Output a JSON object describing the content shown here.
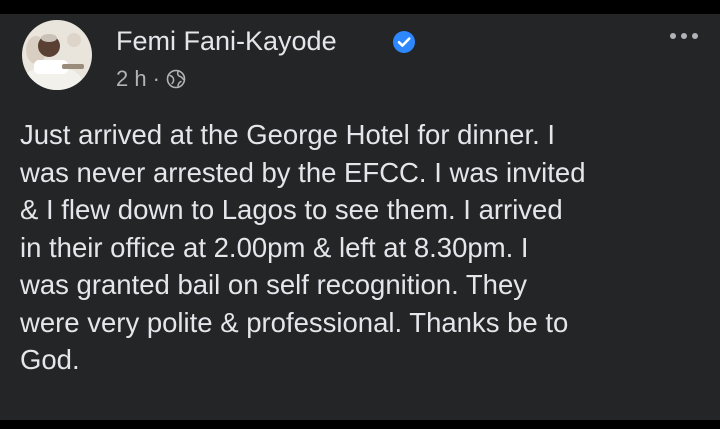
{
  "post": {
    "author": {
      "name": "Femi Fani-Kayode",
      "verified": true,
      "avatar_icon": "profile-photo"
    },
    "meta": {
      "time": "2 h",
      "separator": "·",
      "audience_icon": "globe-icon"
    },
    "more_icon": "more-horizontal-icon",
    "text": "Just arrived at the George Hotel for dinner. I\nwas never arrested by the EFCC. I was invited\n& I flew down to Lagos to see them. I arrived\nin their office at 2.00pm & left at 8.30pm. I\nwas granted bail on self recognition. They\nwere very polite & professional. Thanks be to\nGod."
  },
  "colors": {
    "background": "#000000",
    "card": "#242526",
    "primary_text": "#e4e6eb",
    "secondary_text": "#b0b3b8",
    "verified_badge": "#2d88ff"
  }
}
